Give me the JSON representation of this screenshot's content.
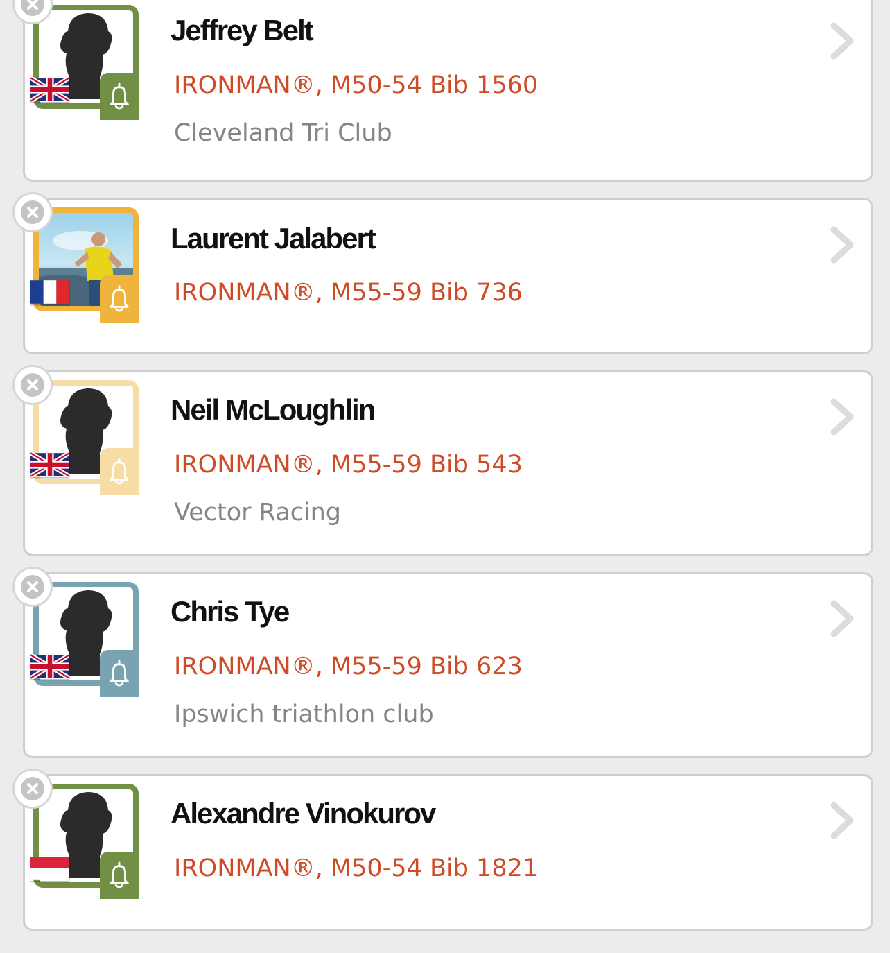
{
  "athletes": [
    {
      "name": "Jeffrey Belt",
      "race": "IRONMAN®, M50-54 Bib 1560",
      "club": "Cleveland Tri Club",
      "country_flag": "united-kingdom",
      "avatar": "silhouette",
      "accent_color": "#718f45"
    },
    {
      "name": "Laurent Jalabert",
      "race": "IRONMAN®, M55-59 Bib 736",
      "club": "",
      "country_flag": "france",
      "avatar": "photo",
      "accent_color": "#f0b43c"
    },
    {
      "name": "Neil McLoughlin",
      "race": "IRONMAN®, M55-59 Bib 543",
      "club": "Vector Racing",
      "country_flag": "united-kingdom",
      "avatar": "silhouette",
      "accent_color": "#f8dca6"
    },
    {
      "name": "Chris Tye",
      "race": "IRONMAN®, M55-59 Bib 623",
      "club": "Ipswich triathlon club",
      "country_flag": "united-kingdom",
      "avatar": "silhouette",
      "accent_color": "#79a3b0"
    },
    {
      "name": "Alexandre Vinokurov",
      "race": "IRONMAN®, M50-54 Bib 1821",
      "club": "",
      "country_flag": "monaco",
      "avatar": "silhouette",
      "accent_color": "#718f45"
    }
  ],
  "icons": {
    "remove": "close-circle-icon",
    "notify": "bell-icon",
    "open": "chevron-right-icon"
  }
}
